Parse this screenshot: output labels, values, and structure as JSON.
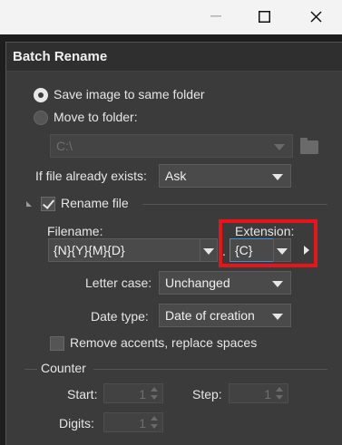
{
  "window": {
    "minimize_icon": "minimize-icon",
    "maximize_icon": "maximize-icon",
    "close_icon": "close-icon"
  },
  "dialog": {
    "title": "Batch Rename",
    "save_same_folder_label": "Save image to same folder",
    "move_to_folder_label": "Move to folder:",
    "folder_path": "C:\\",
    "if_exists_label": "If file already exists:",
    "if_exists_value": "Ask",
    "rename_file_label": "Rename file",
    "filename_label": "Filename:",
    "filename_value": "{N}{Y}{M}{D}",
    "dot": ".",
    "extension_label": "Extension:",
    "extension_value": "{C}",
    "letter_case_label": "Letter case:",
    "letter_case_value": "Unchanged",
    "date_type_label": "Date type:",
    "date_type_value": "Date of creation",
    "remove_accents_label": "Remove accents, replace spaces",
    "counter_label": "Counter",
    "start_label": "Start:",
    "start_value": "1",
    "step_label": "Step:",
    "step_value": "1",
    "digits_label": "Digits:",
    "digits_value": "1"
  },
  "colors": {
    "highlight": "#e8141a",
    "dialog_bg": "#3b3b3b"
  }
}
